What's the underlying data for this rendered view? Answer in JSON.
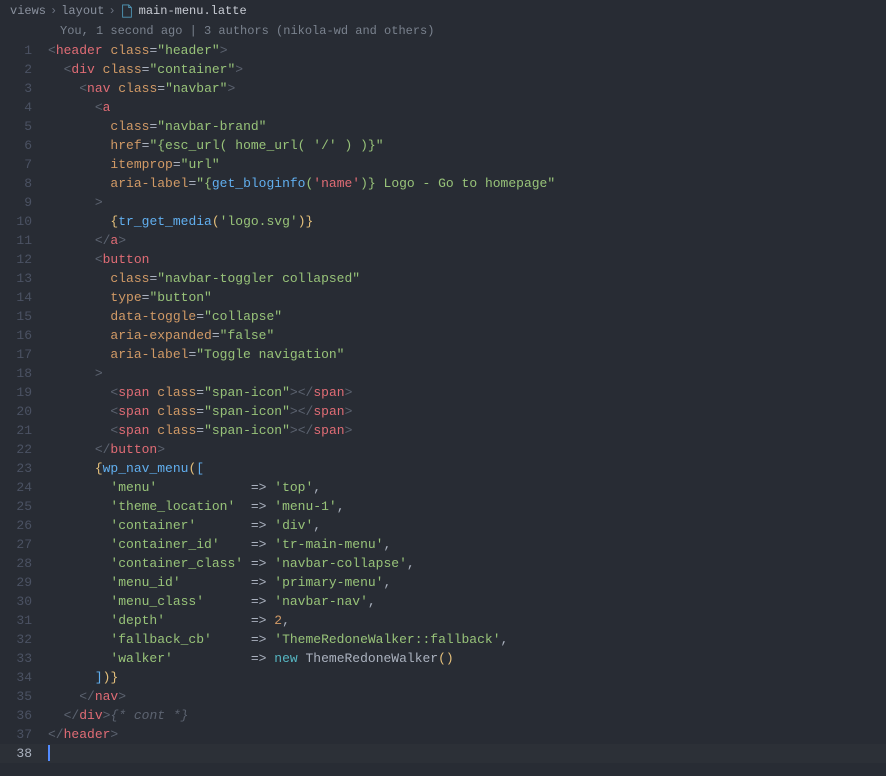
{
  "breadcrumb": {
    "seg1": "views",
    "seg2": "layout",
    "file": "main-menu.latte"
  },
  "authors": "You, 1 second ago | 3 authors (nikola-wd and others)",
  "lines": {
    "l1": {
      "n": "1"
    },
    "l2": {
      "n": "2"
    },
    "l3": {
      "n": "3"
    },
    "l4": {
      "n": "4"
    },
    "l5": {
      "n": "5"
    },
    "l6": {
      "n": "6"
    },
    "l7": {
      "n": "7"
    },
    "l8": {
      "n": "8"
    },
    "l9": {
      "n": "9"
    },
    "l10": {
      "n": "10"
    },
    "l11": {
      "n": "11"
    },
    "l12": {
      "n": "12"
    },
    "l13": {
      "n": "13"
    },
    "l14": {
      "n": "14"
    },
    "l15": {
      "n": "15"
    },
    "l16": {
      "n": "16"
    },
    "l17": {
      "n": "17"
    },
    "l18": {
      "n": "18"
    },
    "l19": {
      "n": "19"
    },
    "l20": {
      "n": "20"
    },
    "l21": {
      "n": "21"
    },
    "l22": {
      "n": "22"
    },
    "l23": {
      "n": "23"
    },
    "l24": {
      "n": "24"
    },
    "l25": {
      "n": "25"
    },
    "l26": {
      "n": "26"
    },
    "l27": {
      "n": "27"
    },
    "l28": {
      "n": "28"
    },
    "l29": {
      "n": "29"
    },
    "l30": {
      "n": "30"
    },
    "l31": {
      "n": "31"
    },
    "l32": {
      "n": "32"
    },
    "l33": {
      "n": "33"
    },
    "l34": {
      "n": "34"
    },
    "l35": {
      "n": "35"
    },
    "l36": {
      "n": "36"
    },
    "l37": {
      "n": "37"
    },
    "l38": {
      "n": "38"
    }
  },
  "tok": {
    "header": "header",
    "div": "div",
    "nav": "nav",
    "a": "a",
    "button": "button",
    "span": "span",
    "class": "class",
    "href": "href",
    "itemprop": "itemprop",
    "aria_label": "aria-label",
    "type": "type",
    "data_toggle": "data-toggle",
    "aria_expanded": "aria-expanded",
    "eq": "=",
    "v_header": "\"header\"",
    "v_container": "\"container\"",
    "v_navbar": "\"navbar\"",
    "v_navbar_brand": "\"navbar-brand\"",
    "v_href": "\"{esc_url( home_url( '/' ) )}\"",
    "v_url": "\"url\"",
    "v_aria1_a": "\"{",
    "v_aria1_b": "get_bloginfo",
    "v_aria1_c": "(",
    "v_aria1_d": "'name'",
    "v_aria1_e": ")",
    "v_aria1_f": "} Logo - Go to homepage\"",
    "v_toggler": "\"navbar-toggler collapsed\"",
    "v_button": "\"button\"",
    "v_collapse": "\"collapse\"",
    "v_false": "\"false\"",
    "v_togglenav": "\"Toggle navigation\"",
    "v_spanicon": "\"span-icon\"",
    "tr_open": "{",
    "tr_fn": "tr_get_media",
    "tr_p1": "(",
    "tr_arg": "'logo.svg'",
    "tr_p2": ")",
    "tr_close": "}",
    "wp_open": "{",
    "wp_fn": "wp_nav_menu",
    "wp_p1": "(",
    "wp_b1": "[",
    "k_menu": "'menu'",
    "k_theme": "'theme_location'",
    "k_cont": "'container'",
    "k_cid": "'container_id'",
    "k_ccls": "'container_class'",
    "k_mid": "'menu_id'",
    "k_mcls": "'menu_class'",
    "k_depth": "'depth'",
    "k_fb": "'fallback_cb'",
    "k_walk": "'walker'",
    "arrow": "=> ",
    "v_top": "'top'",
    "v_menu1": "'menu-1'",
    "v_div": "'div'",
    "v_trmain": "'tr-main-menu'",
    "v_ncoll": "'navbar-collapse'",
    "v_pmenu": "'primary-menu'",
    "v_nnav": "'navbar-nav'",
    "v_2": "2",
    "v_fb": "'ThemeRedoneWalker::fallback'",
    "kw_new": "new ",
    "cls_walker": "ThemeRedoneWalker",
    "paren": "()",
    "wp_b2": "]",
    "wp_p2": ")",
    "wp_close": "}",
    "comma": ",",
    "lt": "<",
    "gt": ">",
    "lts": "</",
    "cont_cmt": "{* cont *}"
  }
}
